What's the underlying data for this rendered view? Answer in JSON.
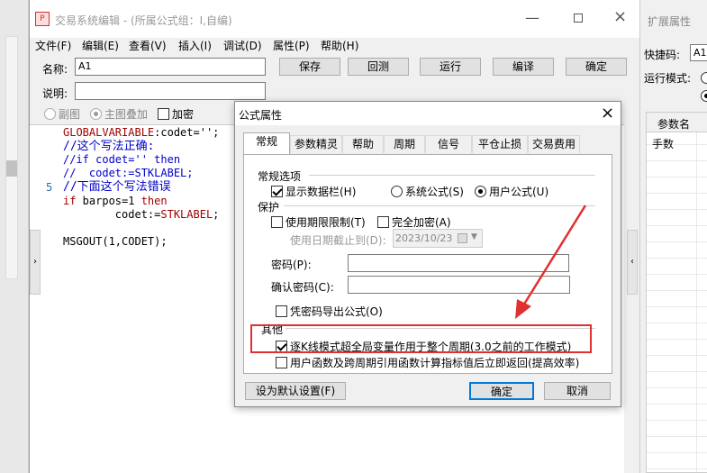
{
  "main_window": {
    "title": "交易系统编辑 - (所属公式组：I,自编)",
    "menu": [
      "文件(F)",
      "编辑(E)",
      "查看(V)",
      "插入(I)",
      "调试(D)",
      "属性(P)",
      "帮助(H)"
    ],
    "name_label": "名称:",
    "name_value": "A1",
    "desc_label": "说明:",
    "desc_value": "",
    "buttons": [
      "保存",
      "回测",
      "运行",
      "编译",
      "确定"
    ],
    "options": {
      "sub_chart": "副图",
      "main_overlay": "主图叠加",
      "encrypt": "加密"
    },
    "line_number": "5"
  },
  "code": {
    "l1_kw": "GLOBALVARIABLE",
    "l1_rest": ":codet='';",
    "l2": "//这个写法正确:",
    "l3": "//if codet='' then",
    "l4": "//  codet:=STKLABEL;",
    "l5": "//下面这个写法错误",
    "l6_kw": "if",
    "l6_rest": " barpos=1 ",
    "l6_then": "then",
    "l7_a": "        codet:=",
    "l7_kw": "STKLABEL",
    "l7_b": ";",
    "l8": "MSGOUT(1,CODET);"
  },
  "right_panel": {
    "title": "扩展属性",
    "shortcut_label": "快捷码:",
    "shortcut_value": "A1",
    "mode_label": "运行模式:",
    "param_header": "参数名",
    "param_row": "手数"
  },
  "dialog": {
    "title": "公式属性",
    "close": "×",
    "tabs": [
      "常规",
      "参数精灵",
      "帮助",
      "周期",
      "信号",
      "平仓止损",
      "交易费用"
    ],
    "group_general": "常规选项",
    "show_data_bar": "显示数据栏(H)",
    "system_formula": "系统公式(S)",
    "user_formula": "用户公式(U)",
    "group_protect": "保护",
    "use_expiry": "使用期限限制(T)",
    "full_encrypt": "完全加密(A)",
    "expiry_date_label": "使用日期截止到(D):",
    "expiry_date": "2023/10/23",
    "password_label": "密码(P):",
    "confirm_password_label": "确认密码(C):",
    "export_with_password": "凭密码导出公式(O)",
    "group_other": "其他",
    "tick_mode": "逐K线模式超全局变量作用于整个周期(3.0之前的工作模式)",
    "user_func": "用户函数及跨周期引用函数计算指标值后立即返回(提高效率)",
    "set_default": "设为默认设置(F)",
    "ok": "确定",
    "cancel": "取消"
  },
  "colors": {
    "keyword": "#a00000",
    "comment": "#0000cc",
    "annotation": "#e03030",
    "accent": "#0078d7"
  }
}
